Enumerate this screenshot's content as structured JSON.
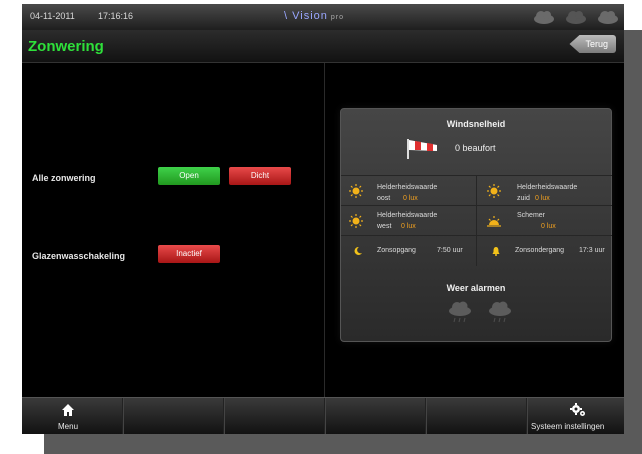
{
  "status_bar": {
    "date": "04-11-2011",
    "time": "17:16:16",
    "brand": "\\ Vision",
    "brand_suffix": "pro",
    "weather_icons": [
      "cloud-icon",
      "cloud-icon",
      "cloud-icon"
    ]
  },
  "header": {
    "title": "Zonwering",
    "back_label": "Terug",
    "title_color": "#2ee03a"
  },
  "controls": {
    "row1": {
      "label": "Alle zonwering",
      "open_label": "Open",
      "close_label": "Dicht"
    },
    "row2": {
      "label": "Glazenwasschakeling",
      "button_label": "Inactief"
    }
  },
  "weather": {
    "wind_title": "Windsnelheid",
    "wind_value": "0 beaufort",
    "sensors": [
      {
        "label": "Helderheidswaarde",
        "label2": "oost",
        "value": "0 lux",
        "icon": "sun-icon"
      },
      {
        "label": "Helderheidswaarde",
        "label2": "zuid",
        "value": "0 lux",
        "icon": "sun-icon"
      },
      {
        "label": "Helderheidswaarde",
        "label2": "west",
        "value": "0 lux",
        "icon": "sun-icon"
      },
      {
        "label": "Schemer",
        "label2": "",
        "value": "0 lux",
        "icon": "sunset-icon"
      }
    ],
    "sunrise": {
      "label": "Zonsopgang",
      "time": "7:50 uur"
    },
    "sunset": {
      "label": "Zonsondergang",
      "time": "17:3 uur"
    },
    "alarm_title": "Weer alarmen",
    "alarm_icons": [
      "cloud-icon",
      "cloud-icon"
    ],
    "accent_value_color": "#f0a020"
  },
  "nav": {
    "menu_label": "Menu",
    "settings_label": "Systeem instellingen"
  }
}
